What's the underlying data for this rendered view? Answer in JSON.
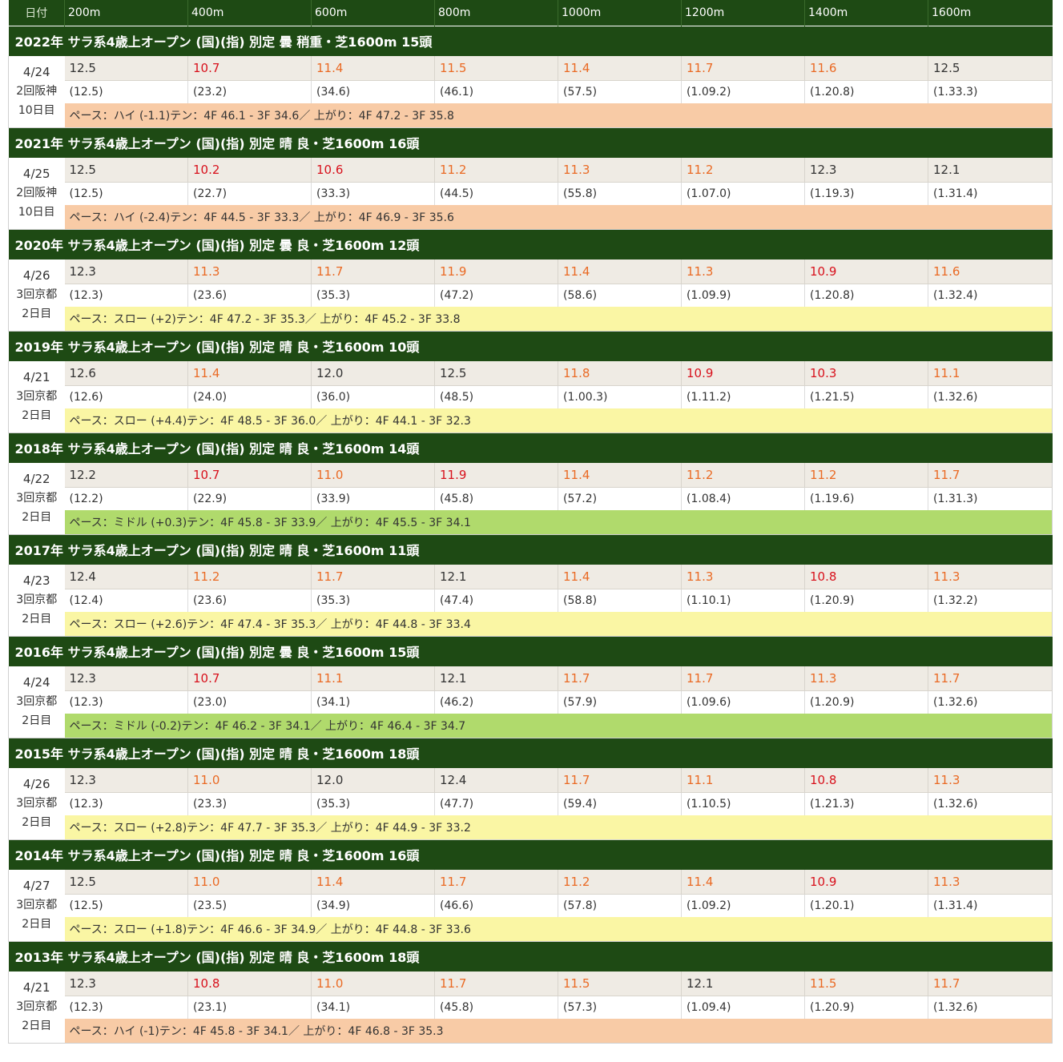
{
  "columns": [
    "日付",
    "200m",
    "400m",
    "600m",
    "800m",
    "1000m",
    "1200m",
    "1400m",
    "1600m"
  ],
  "races": [
    {
      "title": "2022年 サラ系4歳上オープン (国)(指) 別定 曇 稍重・芝1600m 15頭",
      "date": "4/24",
      "venue": "2回阪神",
      "day": "10日目",
      "laps": [
        [
          "12.5",
          "k"
        ],
        [
          "10.7",
          "r"
        ],
        [
          "11.4",
          "o"
        ],
        [
          "11.5",
          "o"
        ],
        [
          "11.4",
          "o"
        ],
        [
          "11.7",
          "o"
        ],
        [
          "11.6",
          "o"
        ],
        [
          "12.5",
          "k"
        ]
      ],
      "cum": [
        "(12.5)",
        "(23.2)",
        "(34.6)",
        "(46.1)",
        "(57.5)",
        "(1.09.2)",
        "(1.20.8)",
        "(1.33.3)"
      ],
      "pace": "ペース：ハイ (-1.1)テン：4F 46.1 - 3F 34.6／ 上がり：4F 47.2 - 3F 35.8",
      "pace_type": "high"
    },
    {
      "title": "2021年 サラ系4歳上オープン (国)(指) 別定 晴 良・芝1600m 16頭",
      "date": "4/25",
      "venue": "2回阪神",
      "day": "10日目",
      "laps": [
        [
          "12.5",
          "k"
        ],
        [
          "10.2",
          "r"
        ],
        [
          "10.6",
          "r"
        ],
        [
          "11.2",
          "o"
        ],
        [
          "11.3",
          "o"
        ],
        [
          "11.2",
          "o"
        ],
        [
          "12.3",
          "k"
        ],
        [
          "12.1",
          "k"
        ]
      ],
      "cum": [
        "(12.5)",
        "(22.7)",
        "(33.3)",
        "(44.5)",
        "(55.8)",
        "(1.07.0)",
        "(1.19.3)",
        "(1.31.4)"
      ],
      "pace": "ペース：ハイ (-2.4)テン：4F 44.5 - 3F 33.3／ 上がり：4F 46.9 - 3F 35.6",
      "pace_type": "high"
    },
    {
      "title": "2020年 サラ系4歳上オープン (国)(指) 別定 曇 良・芝1600m 12頭",
      "date": "4/26",
      "venue": "3回京都",
      "day": "2日目",
      "laps": [
        [
          "12.3",
          "k"
        ],
        [
          "11.3",
          "o"
        ],
        [
          "11.7",
          "o"
        ],
        [
          "11.9",
          "o"
        ],
        [
          "11.4",
          "o"
        ],
        [
          "11.3",
          "o"
        ],
        [
          "10.9",
          "r"
        ],
        [
          "11.6",
          "o"
        ]
      ],
      "cum": [
        "(12.3)",
        "(23.6)",
        "(35.3)",
        "(47.2)",
        "(58.6)",
        "(1.09.9)",
        "(1.20.8)",
        "(1.32.4)"
      ],
      "pace": "ペース：スロー (+2)テン：4F 47.2 - 3F 35.3／ 上がり：4F 45.2 - 3F 33.8",
      "pace_type": "slow"
    },
    {
      "title": "2019年 サラ系4歳上オープン (国)(指) 別定 晴 良・芝1600m 10頭",
      "date": "4/21",
      "venue": "3回京都",
      "day": "2日目",
      "laps": [
        [
          "12.6",
          "k"
        ],
        [
          "11.4",
          "o"
        ],
        [
          "12.0",
          "k"
        ],
        [
          "12.5",
          "k"
        ],
        [
          "11.8",
          "o"
        ],
        [
          "10.9",
          "r"
        ],
        [
          "10.3",
          "r"
        ],
        [
          "11.1",
          "o"
        ]
      ],
      "cum": [
        "(12.6)",
        "(24.0)",
        "(36.0)",
        "(48.5)",
        "(1.00.3)",
        "(1.11.2)",
        "(1.21.5)",
        "(1.32.6)"
      ],
      "pace": "ペース：スロー (+4.4)テン：4F 48.5 - 3F 36.0／ 上がり：4F 44.1 - 3F 32.3",
      "pace_type": "slow"
    },
    {
      "title": "2018年 サラ系4歳上オープン (国)(指) 別定 晴 良・芝1600m 14頭",
      "date": "4/22",
      "venue": "3回京都",
      "day": "2日目",
      "laps": [
        [
          "12.2",
          "k"
        ],
        [
          "10.7",
          "r"
        ],
        [
          "11.0",
          "o"
        ],
        [
          "11.9",
          "r"
        ],
        [
          "11.4",
          "o"
        ],
        [
          "11.2",
          "o"
        ],
        [
          "11.2",
          "o"
        ],
        [
          "11.7",
          "o"
        ]
      ],
      "cum": [
        "(12.2)",
        "(22.9)",
        "(33.9)",
        "(45.8)",
        "(57.2)",
        "(1.08.4)",
        "(1.19.6)",
        "(1.31.3)"
      ],
      "pace": "ペース：ミドル (+0.3)テン：4F 45.8 - 3F 33.9／ 上がり：4F 45.5 - 3F 34.1",
      "pace_type": "middle"
    },
    {
      "title": "2017年 サラ系4歳上オープン (国)(指) 別定 晴 良・芝1600m 11頭",
      "date": "4/23",
      "venue": "3回京都",
      "day": "2日目",
      "laps": [
        [
          "12.4",
          "k"
        ],
        [
          "11.2",
          "o"
        ],
        [
          "11.7",
          "o"
        ],
        [
          "12.1",
          "k"
        ],
        [
          "11.4",
          "o"
        ],
        [
          "11.3",
          "o"
        ],
        [
          "10.8",
          "r"
        ],
        [
          "11.3",
          "o"
        ]
      ],
      "cum": [
        "(12.4)",
        "(23.6)",
        "(35.3)",
        "(47.4)",
        "(58.8)",
        "(1.10.1)",
        "(1.20.9)",
        "(1.32.2)"
      ],
      "pace": "ペース：スロー (+2.6)テン：4F 47.4 - 3F 35.3／ 上がり：4F 44.8 - 3F 33.4",
      "pace_type": "slow"
    },
    {
      "title": "2016年 サラ系4歳上オープン (国)(指) 別定 曇 良・芝1600m 15頭",
      "date": "4/24",
      "venue": "3回京都",
      "day": "2日目",
      "laps": [
        [
          "12.3",
          "k"
        ],
        [
          "10.7",
          "r"
        ],
        [
          "11.1",
          "o"
        ],
        [
          "12.1",
          "k"
        ],
        [
          "11.7",
          "o"
        ],
        [
          "11.7",
          "o"
        ],
        [
          "11.3",
          "o"
        ],
        [
          "11.7",
          "o"
        ]
      ],
      "cum": [
        "(12.3)",
        "(23.0)",
        "(34.1)",
        "(46.2)",
        "(57.9)",
        "(1.09.6)",
        "(1.20.9)",
        "(1.32.6)"
      ],
      "pace": "ペース：ミドル (-0.2)テン：4F 46.2 - 3F 34.1／ 上がり：4F 46.4 - 3F 34.7",
      "pace_type": "middle"
    },
    {
      "title": "2015年 サラ系4歳上オープン (国)(指) 別定 晴 良・芝1600m 18頭",
      "date": "4/26",
      "venue": "3回京都",
      "day": "2日目",
      "laps": [
        [
          "12.3",
          "k"
        ],
        [
          "11.0",
          "o"
        ],
        [
          "12.0",
          "k"
        ],
        [
          "12.4",
          "k"
        ],
        [
          "11.7",
          "o"
        ],
        [
          "11.1",
          "o"
        ],
        [
          "10.8",
          "r"
        ],
        [
          "11.3",
          "o"
        ]
      ],
      "cum": [
        "(12.3)",
        "(23.3)",
        "(35.3)",
        "(47.7)",
        "(59.4)",
        "(1.10.5)",
        "(1.21.3)",
        "(1.32.6)"
      ],
      "pace": "ペース：スロー (+2.8)テン：4F 47.7 - 3F 35.3／ 上がり：4F 44.9 - 3F 33.2",
      "pace_type": "slow"
    },
    {
      "title": "2014年 サラ系4歳上オープン (国)(指) 別定 晴 良・芝1600m 16頭",
      "date": "4/27",
      "venue": "3回京都",
      "day": "2日目",
      "laps": [
        [
          "12.5",
          "k"
        ],
        [
          "11.0",
          "o"
        ],
        [
          "11.4",
          "o"
        ],
        [
          "11.7",
          "o"
        ],
        [
          "11.2",
          "o"
        ],
        [
          "11.4",
          "o"
        ],
        [
          "10.9",
          "r"
        ],
        [
          "11.3",
          "o"
        ]
      ],
      "cum": [
        "(12.5)",
        "(23.5)",
        "(34.9)",
        "(46.6)",
        "(57.8)",
        "(1.09.2)",
        "(1.20.1)",
        "(1.31.4)"
      ],
      "pace": "ペース：スロー (+1.8)テン：4F 46.6 - 3F 34.9／ 上がり：4F 44.8 - 3F 33.6",
      "pace_type": "slow"
    },
    {
      "title": "2013年 サラ系4歳上オープン (国)(指) 別定 晴 良・芝1600m 18頭",
      "date": "4/21",
      "venue": "3回京都",
      "day": "2日目",
      "laps": [
        [
          "12.3",
          "k"
        ],
        [
          "10.8",
          "r"
        ],
        [
          "11.0",
          "o"
        ],
        [
          "11.7",
          "o"
        ],
        [
          "11.5",
          "o"
        ],
        [
          "12.1",
          "k"
        ],
        [
          "11.5",
          "o"
        ],
        [
          "11.7",
          "o"
        ]
      ],
      "cum": [
        "(12.3)",
        "(23.1)",
        "(34.1)",
        "(45.8)",
        "(57.3)",
        "(1.09.4)",
        "(1.20.9)",
        "(1.32.6)"
      ],
      "pace": "ペース：ハイ (-1)テン：4F 45.8 - 3F 34.1／ 上がり：4F 46.8 - 3F 35.3",
      "pace_type": "high"
    }
  ]
}
